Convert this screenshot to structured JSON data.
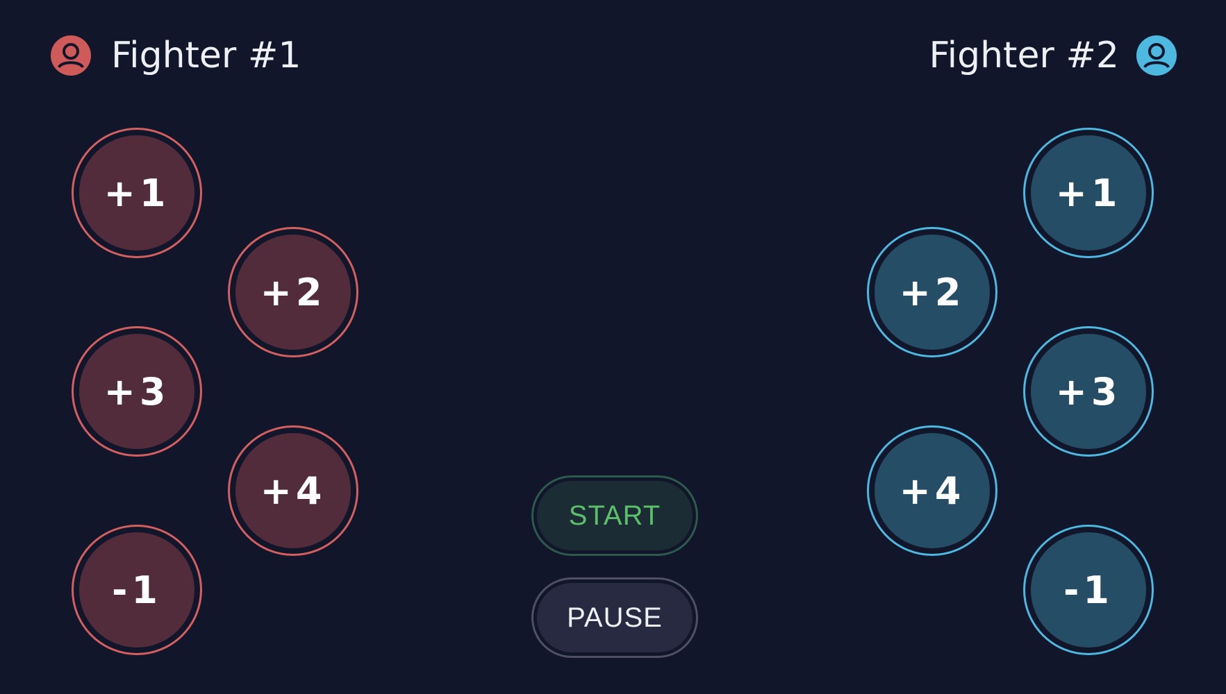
{
  "colors": {
    "background": "#12162a",
    "fighter1_accent": "#d45f5f",
    "fighter1_fill": "#532c3c",
    "fighter2_accent": "#4db8e0",
    "fighter2_fill": "#254d66",
    "start_text": "#5cc06a"
  },
  "fighter1": {
    "name": "Fighter #1",
    "avatar_icon": "user-circle-icon",
    "buttons": [
      "+1",
      "+2",
      "+3",
      "+4",
      "-1"
    ]
  },
  "fighter2": {
    "name": "Fighter #2",
    "avatar_icon": "user-circle-icon",
    "buttons": [
      "+1",
      "+2",
      "+3",
      "+4",
      "-1"
    ]
  },
  "controls": {
    "start_label": "START",
    "pause_label": "PAUSE"
  }
}
